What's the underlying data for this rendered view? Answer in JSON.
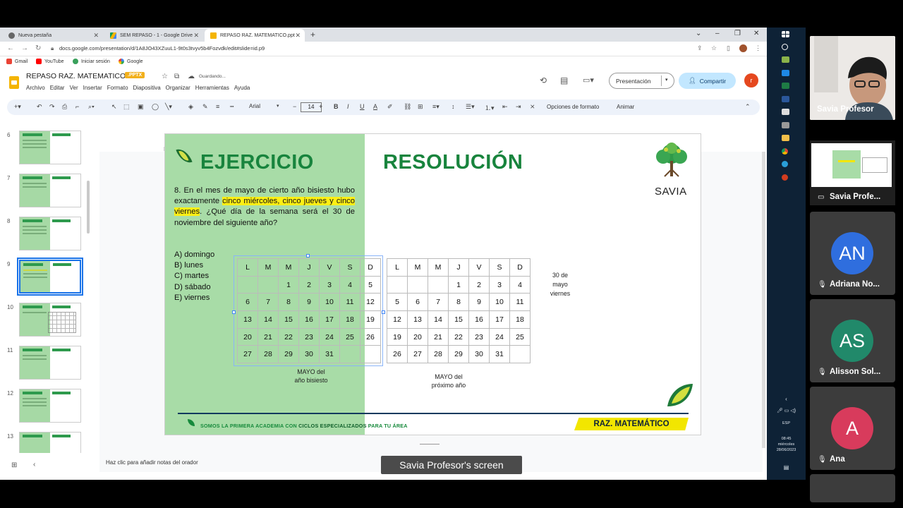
{
  "browser": {
    "tabs": [
      {
        "label": "Nueva pestaña",
        "icon": "chrome-icon"
      },
      {
        "label": "SEM REPASO - 1 - Google Drive",
        "icon": "drive-icon"
      },
      {
        "label": "REPASO RAZ. MATEMATICO.ppt",
        "icon": "slides-icon"
      }
    ],
    "url": "docs.google.com/presentation/d/1A8JO43XZuuL1-9t0s3tvyv5b4Fozvdk/edit#slide=id.p9",
    "bookmarks": [
      "Gmail",
      "YouTube",
      "Iniciar sesión",
      "Google"
    ]
  },
  "app": {
    "title": "REPASO RAZ. MATEMATICO",
    "badge": ".PPTX",
    "status": "Guardando...",
    "menu": [
      "Archivo",
      "Editar",
      "Ver",
      "Insertar",
      "Formato",
      "Diapositiva",
      "Organizar",
      "Herramientas",
      "Ayuda"
    ],
    "present_label": "Presentación",
    "share_label": "Compartir",
    "user_initial": "r"
  },
  "toolbar": {
    "font": "Arial",
    "size": "14",
    "format_options": "Opciones de formato",
    "animate": "Animar"
  },
  "filmstrip": {
    "slides": [
      "6",
      "7",
      "8",
      "9",
      "10",
      "11",
      "12",
      "13"
    ],
    "selected": "9"
  },
  "slide": {
    "heading_left": "EJERCICIO",
    "heading_right": "RESOLUCIÓN",
    "problem_p1": "8. En el mes de mayo de cierto año bisiesto hubo exactamente ",
    "problem_hl1": "cinco miércoles, cinco jueves y cinco viernes",
    "problem_p2": ". ¿Qué día de la semana será el 30 de noviembre del siguiente año?",
    "options": [
      "A) domingo",
      "B) lunes",
      "C) martes",
      "D) sábado",
      "E) viernes"
    ],
    "calendar1": {
      "days": [
        "L",
        "M",
        "M",
        "J",
        "V",
        "S",
        "D"
      ],
      "rows": [
        [
          "",
          "",
          "1",
          "2",
          "3",
          "4",
          "5"
        ],
        [
          "6",
          "7",
          "8",
          "9",
          "10",
          "11",
          "12"
        ],
        [
          "13",
          "14",
          "15",
          "16",
          "17",
          "18",
          "19"
        ],
        [
          "20",
          "21",
          "22",
          "23",
          "24",
          "25",
          "26"
        ],
        [
          "27",
          "28",
          "29",
          "30",
          "31",
          "",
          ""
        ]
      ],
      "caption_line1": "MAYO del",
      "caption_line2": "año bisiesto"
    },
    "calendar2": {
      "days": [
        "L",
        "M",
        "M",
        "J",
        "V",
        "S",
        "D"
      ],
      "rows": [
        [
          "",
          "",
          "",
          "1",
          "2",
          "3",
          "4"
        ],
        [
          "5",
          "6",
          "7",
          "8",
          "9",
          "10",
          "11"
        ],
        [
          "12",
          "13",
          "14",
          "15",
          "16",
          "17",
          "18"
        ],
        [
          "19",
          "20",
          "21",
          "22",
          "23",
          "24",
          "25"
        ],
        [
          "26",
          "27",
          "28",
          "29",
          "30",
          "31",
          ""
        ]
      ],
      "caption_line1": "MAYO del",
      "caption_line2": "próximo año"
    },
    "note_lines": [
      "30 de",
      "mayo",
      "viernes"
    ],
    "brand": "SAVIA",
    "footer_part1": "SOMOS LA PRIMERA ACADEMIA CON ",
    "footer_bold": "CICLOS ESPECIALIZADOS",
    "footer_part2": " PARA TU ÁREA",
    "footer_subject": "RAZ. MATEMÁTICO"
  },
  "notes_placeholder": "Haz clic para añadir notas del orador",
  "taskbar": {
    "lang": "ESP",
    "time": "08:45",
    "day": "miércoles",
    "date": "28/06/2023"
  },
  "meeting": {
    "screen_label": "Savia Profesor's screen",
    "presenter_name": "Savia Profesor",
    "share_name": "Savia Profe...",
    "participants": [
      {
        "initials": "AN",
        "name": "Adriana No...",
        "color": "#2f6ede"
      },
      {
        "initials": "AS",
        "name": "Alisson Sol...",
        "color": "#21896a"
      },
      {
        "initials": "A",
        "name": "Ana",
        "color": "#d83b5c"
      }
    ]
  }
}
